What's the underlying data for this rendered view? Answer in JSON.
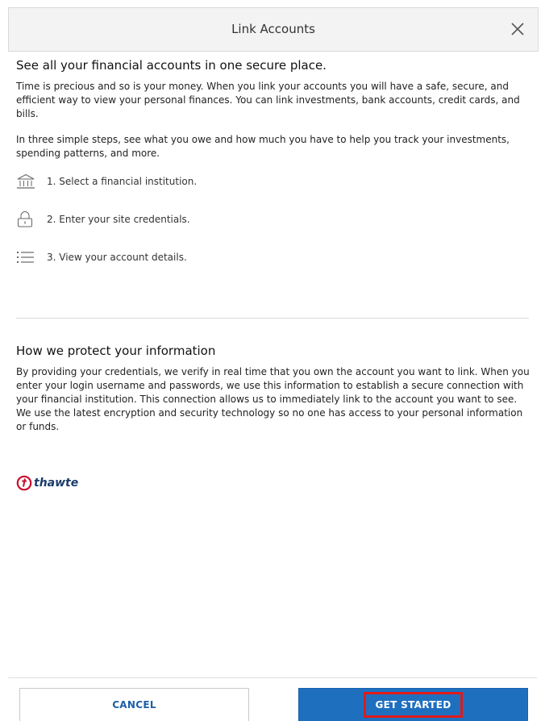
{
  "dialog": {
    "title": "Link Accounts",
    "close_icon": "close-icon"
  },
  "intro": {
    "heading": "See all your financial accounts in one secure place.",
    "para1": "Time is precious and so is your money. When you link your accounts you will have a safe, secure, and efficient way to view your personal finances. You can link investments, bank accounts, credit cards, and bills.",
    "para2": "In three simple steps, see what you owe and how much you have to help you track your investments, spending patterns, and more."
  },
  "steps": [
    {
      "icon": "bank-icon",
      "label": "1. Select a financial institution."
    },
    {
      "icon": "lock-icon",
      "label": "2. Enter your site credentials."
    },
    {
      "icon": "list-icon",
      "label": "3. View your account details."
    }
  ],
  "protect": {
    "heading": "How we protect your information",
    "para": "By providing your credentials, we verify in real time that you own the account you want to link. When you enter your login username and passwords, we use this information to establish a secure connection with your financial institution. This connection allows us to immediately link to the account you want to see. We use the latest encryption and security technology so no one has access to your personal information or funds."
  },
  "badge": {
    "logo_text": "thawte",
    "logo_color": "#c8102e",
    "text_color": "#1b3b6b"
  },
  "footer": {
    "cancel_label": "CANCEL",
    "start_label": "GET STARTED",
    "start_color": "#1f6fbf",
    "highlight_color": "#e01a1a"
  }
}
